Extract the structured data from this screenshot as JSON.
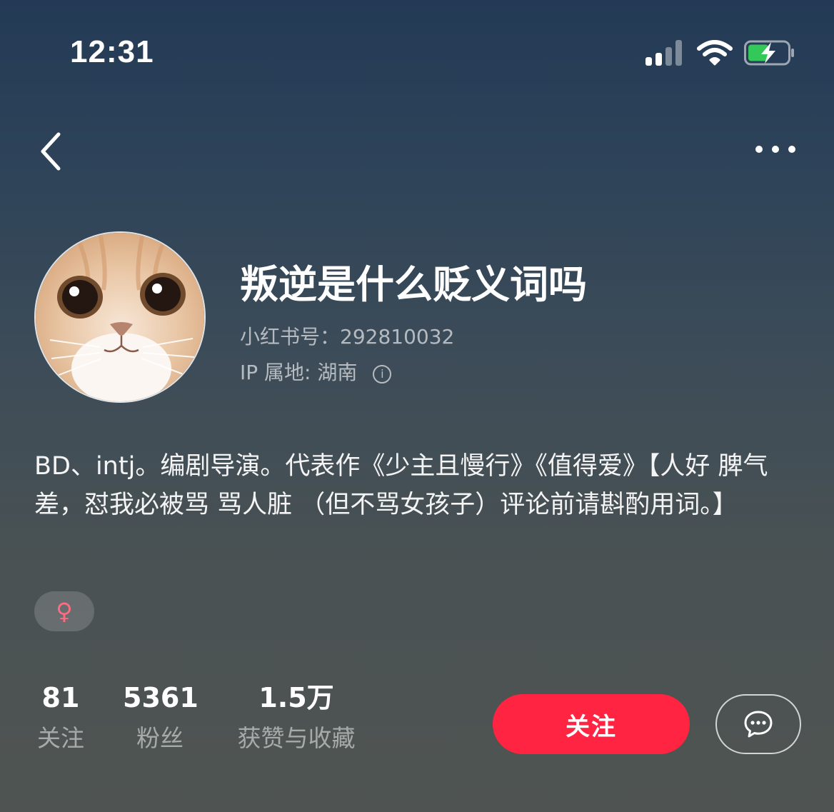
{
  "status_bar": {
    "time": "12:31",
    "icons": [
      "cellular-signal-icon",
      "wifi-icon",
      "battery-charging-icon"
    ],
    "battery_color": "#34c759"
  },
  "nav": {
    "back_icon": "chevron-left-icon",
    "more_icon": "more-horizontal-icon"
  },
  "profile": {
    "avatar": "cat-face-avatar",
    "username": "叛逆是什么贬义词吗",
    "id_line": "小红书号：292810032",
    "ip_line": "IP 属地: 湖南",
    "info_icon_glyph": "i",
    "bio": "BD、intj。编剧导演。代表作《少主且慢行》《值得爱》【人好 脾气差，怼我必被骂 骂人脏 （但不骂女孩子）评论前请斟酌用词。】",
    "gender_icon": "female-icon",
    "gender_glyph": "♀",
    "gender_color": "#ff6b81"
  },
  "stats": [
    {
      "value": "81",
      "label": "关注"
    },
    {
      "value": "5361",
      "label": "粉丝"
    },
    {
      "value": "1.5万",
      "label": "获赞与收藏"
    }
  ],
  "actions": {
    "follow_label": "关注",
    "follow_color": "#ff2442",
    "chat_icon": "chat-bubble-icon"
  }
}
